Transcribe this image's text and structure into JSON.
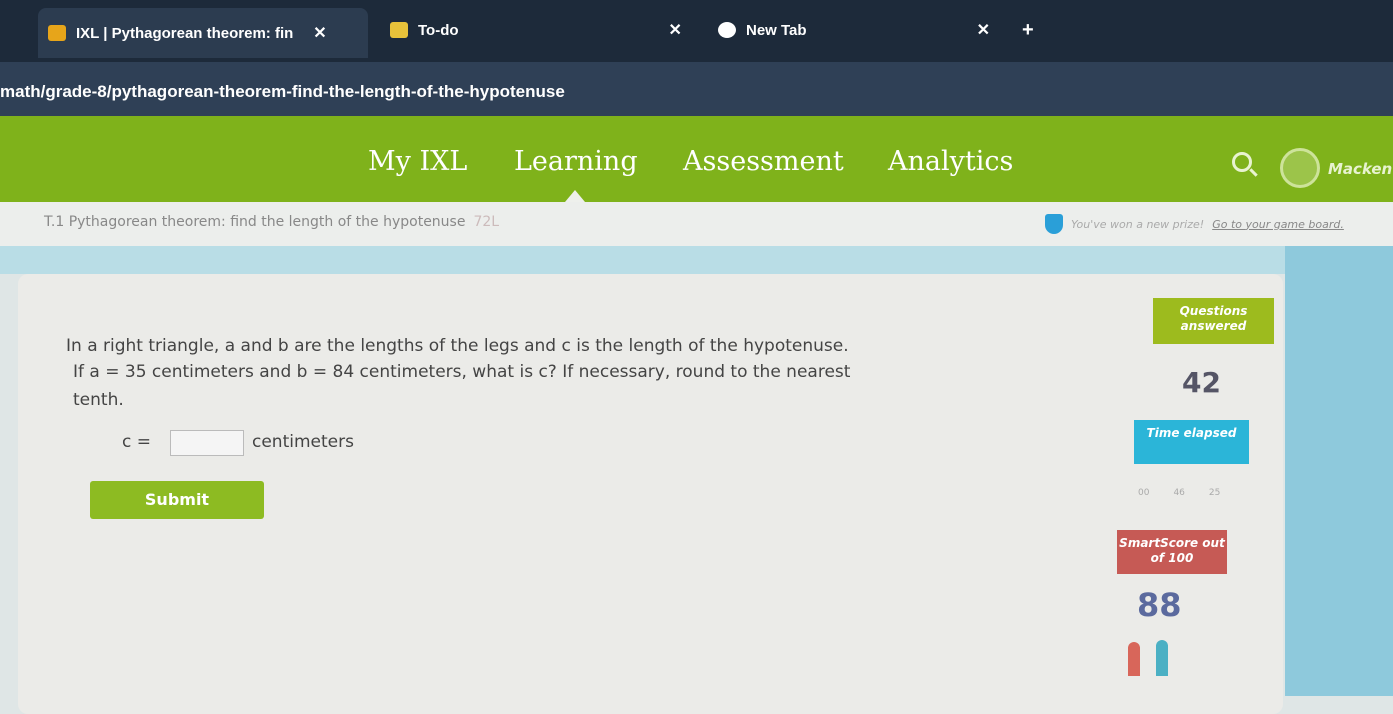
{
  "tabs": [
    {
      "title": "IXL | Pythagorean theorem: fin",
      "active": true
    },
    {
      "title": "To-do",
      "active": false
    },
    {
      "title": "New Tab",
      "active": false
    }
  ],
  "address": "math/grade-8/pythagorean-theorem-find-the-length-of-the-hypotenuse",
  "nav": {
    "items": [
      "My IXL",
      "Learning",
      "Assessment",
      "Analytics"
    ],
    "user": "Macken"
  },
  "breadcrumb": {
    "skill": "T.1 Pythagorean theorem: find the length of the hypotenuse",
    "code": "72L",
    "prize": "You've won a new prize!",
    "prize_link": "Go to your game board."
  },
  "question": {
    "line1": "In a right triangle, a and b are the lengths of the legs and c is the length of the hypotenuse.",
    "line2": "If a = 35 centimeters and b = 84 centimeters, what is c? If necessary, round to the nearest",
    "line3": "tenth.",
    "answer_label": "c =",
    "answer_value": "",
    "unit": "centimeters",
    "submit": "Submit"
  },
  "stats": {
    "questions_label": "Questions answered",
    "questions": "42",
    "time_label": "Time elapsed",
    "time": [
      "00",
      "46",
      "25"
    ],
    "score_label": "SmartScore out of 100",
    "score": "88"
  },
  "colors": {
    "green": "#7fb21b",
    "blue": "#2bb5d8",
    "red": "#c65a55"
  }
}
